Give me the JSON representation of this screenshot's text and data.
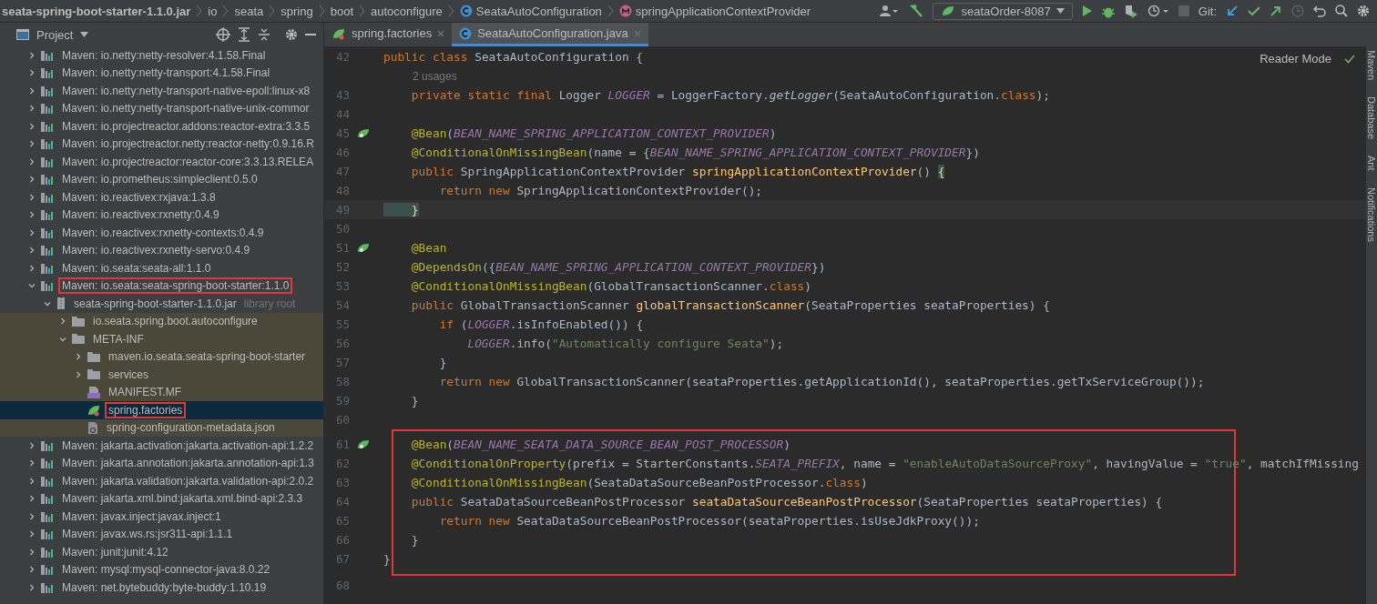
{
  "breadcrumb": [
    {
      "kind": "plain",
      "label": "seata-spring-boot-starter-1.1.0.jar"
    },
    {
      "kind": "plain",
      "label": "io"
    },
    {
      "kind": "plain",
      "label": "seata"
    },
    {
      "kind": "plain",
      "label": "spring"
    },
    {
      "kind": "plain",
      "label": "boot"
    },
    {
      "kind": "plain",
      "label": "autoconfigure"
    },
    {
      "kind": "class",
      "label": "SeataAutoConfiguration"
    },
    {
      "kind": "method",
      "label": "springApplicationContextProvider"
    }
  ],
  "toolbar": {
    "run_config": "seataOrder-8087",
    "git_label": "Git:"
  },
  "project_panel": {
    "title": "Project",
    "tree": [
      {
        "label": "Maven: io.netty:netty-resolver:4.1.58.Final",
        "kind": "library",
        "expanded": false,
        "selected": false,
        "boxed": false
      },
      {
        "label": "Maven: io.netty:netty-transport:4.1.58.Final",
        "kind": "library",
        "expanded": false,
        "selected": false,
        "boxed": false
      },
      {
        "label": "Maven: io.netty:netty-transport-native-epoll:linux-x8",
        "kind": "library",
        "expanded": false,
        "selected": false,
        "boxed": false
      },
      {
        "label": "Maven: io.netty:netty-transport-native-unix-commor",
        "kind": "library",
        "expanded": false,
        "selected": false,
        "boxed": false
      },
      {
        "label": "Maven: io.projectreactor.addons:reactor-extra:3.3.5",
        "kind": "library",
        "expanded": false,
        "selected": false,
        "boxed": false
      },
      {
        "label": "Maven: io.projectreactor.netty:reactor-netty:0.9.16.R",
        "kind": "library",
        "expanded": false,
        "selected": false,
        "boxed": false
      },
      {
        "label": "Maven: io.projectreactor:reactor-core:3.3.13.RELEA",
        "kind": "library",
        "expanded": false,
        "selected": false,
        "boxed": false
      },
      {
        "label": "Maven: io.prometheus:simpleclient:0.5.0",
        "kind": "library",
        "expanded": false,
        "selected": false,
        "boxed": false
      },
      {
        "label": "Maven: io.reactivex:rxjava:1.3.8",
        "kind": "library",
        "expanded": false,
        "selected": false,
        "boxed": false
      },
      {
        "label": "Maven: io.reactivex:rxnetty:0.4.9",
        "kind": "library",
        "expanded": false,
        "selected": false,
        "boxed": false
      },
      {
        "label": "Maven: io.reactivex:rxnetty-contexts:0.4.9",
        "kind": "library",
        "expanded": false,
        "selected": false,
        "boxed": false
      },
      {
        "label": "Maven: io.reactivex:rxnetty-servo:0.4.9",
        "kind": "library",
        "expanded": false,
        "selected": false,
        "boxed": false
      },
      {
        "label": "Maven: io.seata:seata-all:1.1.0",
        "kind": "library",
        "expanded": false,
        "selected": false,
        "boxed": false
      },
      {
        "label": "Maven: io.seata:seata-spring-boot-starter:1.1.0",
        "kind": "library",
        "expanded": true,
        "selected": false,
        "boxed": true,
        "children": [
          {
            "label": "seata-spring-boot-starter-1.1.0.jar",
            "note": "library root",
            "kind": "jar",
            "expanded": true,
            "selected": false,
            "boxed": false,
            "children": [
              {
                "label": "io.seata.spring.boot.autoconfigure",
                "kind": "folder",
                "expanded": false,
                "selected": false,
                "boxed": false
              },
              {
                "label": "META-INF",
                "kind": "folder",
                "expanded": true,
                "selected": false,
                "boxed": false,
                "children": [
                  {
                    "label": "maven.io.seata.seata-spring-boot-starter",
                    "kind": "folder",
                    "expanded": false,
                    "selected": false,
                    "boxed": false
                  },
                  {
                    "label": "services",
                    "kind": "folder",
                    "expanded": false,
                    "selected": false,
                    "boxed": false
                  },
                  {
                    "label": "MANIFEST.MF",
                    "kind": "manifest",
                    "selected": false,
                    "boxed": false
                  },
                  {
                    "label": "spring.factories",
                    "kind": "spring",
                    "selected": true,
                    "boxed": true
                  },
                  {
                    "label": "spring-configuration-metadata.json",
                    "kind": "json",
                    "selected": false,
                    "boxed": false
                  }
                ]
              }
            ]
          }
        ]
      },
      {
        "label": "Maven: jakarta.activation:jakarta.activation-api:1.2.2",
        "kind": "library",
        "expanded": false,
        "selected": false,
        "boxed": false
      },
      {
        "label": "Maven: jakarta.annotation:jakarta.annotation-api:1.3",
        "kind": "library",
        "expanded": false,
        "selected": false,
        "boxed": false
      },
      {
        "label": "Maven: jakarta.validation:jakarta.validation-api:2.0.2",
        "kind": "library",
        "expanded": false,
        "selected": false,
        "boxed": false
      },
      {
        "label": "Maven: jakarta.xml.bind:jakarta.xml.bind-api:2.3.3",
        "kind": "library",
        "expanded": false,
        "selected": false,
        "boxed": false
      },
      {
        "label": "Maven: javax.inject:javax.inject:1",
        "kind": "library",
        "expanded": false,
        "selected": false,
        "boxed": false
      },
      {
        "label": "Maven: javax.ws.rs:jsr311-api:1.1.1",
        "kind": "library",
        "expanded": false,
        "selected": false,
        "boxed": false
      },
      {
        "label": "Maven: junit:junit:4.12",
        "kind": "library",
        "expanded": false,
        "selected": false,
        "boxed": false
      },
      {
        "label": "Maven: mysql:mysql-connector-java:8.0.22",
        "kind": "library",
        "expanded": false,
        "selected": false,
        "boxed": false
      },
      {
        "label": "Maven: net.bytebuddy:byte-buddy:1.10.19",
        "kind": "library",
        "expanded": false,
        "selected": false,
        "boxed": false
      }
    ]
  },
  "tabs": [
    {
      "label": "spring.factories",
      "kind": "spring",
      "selected": false
    },
    {
      "label": "SeataAutoConfiguration.java",
      "kind": "class",
      "selected": true
    }
  ],
  "editor": {
    "reader_mode": "Reader Mode",
    "lines": [
      {
        "kind": "code",
        "number": "42",
        "bean_marker": false,
        "current": false,
        "boxed": false,
        "tokens": [
          {
            "kind": "keyword",
            "text": "public class "
          },
          {
            "kind": "plain",
            "text": "SeataAutoConfiguration {"
          }
        ]
      },
      {
        "kind": "hint",
        "text": "2 usages"
      },
      {
        "kind": "code",
        "number": "43",
        "bean_marker": false,
        "current": false,
        "boxed": false,
        "tokens": [
          {
            "kind": "keyword",
            "text": "    private static final "
          },
          {
            "kind": "plain",
            "text": "Logger "
          },
          {
            "kind": "constant",
            "text": "LOGGER"
          },
          {
            "kind": "plain",
            "text": " = LoggerFactory."
          },
          {
            "kind": "call",
            "text": "getLogger"
          },
          {
            "kind": "plain",
            "text": "(SeataAutoConfiguration."
          },
          {
            "kind": "keyword",
            "text": "class"
          },
          {
            "kind": "plain",
            "text": ");"
          }
        ]
      },
      {
        "kind": "code",
        "number": "44",
        "bean_marker": false,
        "current": false,
        "boxed": false
      },
      {
        "kind": "code",
        "number": "45",
        "bean_marker": true,
        "current": false,
        "boxed": false,
        "tokens": [
          {
            "kind": "annotation",
            "text": "    @Bean"
          },
          {
            "kind": "plain",
            "text": "("
          },
          {
            "kind": "constant",
            "text": "BEAN_NAME_SPRING_APPLICATION_CONTEXT_PROVIDER"
          },
          {
            "kind": "plain",
            "text": ")"
          }
        ]
      },
      {
        "kind": "code",
        "number": "46",
        "bean_marker": false,
        "current": false,
        "boxed": false,
        "tokens": [
          {
            "kind": "annotation",
            "text": "    @ConditionalOnMissingBean"
          },
          {
            "kind": "plain",
            "text": "(name = {"
          },
          {
            "kind": "constant",
            "text": "BEAN_NAME_SPRING_APPLICATION_CONTEXT_PROVIDER"
          },
          {
            "kind": "plain",
            "text": "})"
          }
        ]
      },
      {
        "kind": "code",
        "number": "47",
        "bean_marker": false,
        "current": false,
        "boxed": false,
        "tokens": [
          {
            "kind": "keyword",
            "text": "    public "
          },
          {
            "kind": "plain",
            "text": "SpringApplicationContextProvider "
          },
          {
            "kind": "method",
            "text": "springApplicationContextProvider"
          },
          {
            "kind": "plain",
            "text": "() "
          },
          {
            "kind": "brace",
            "text": "{"
          }
        ]
      },
      {
        "kind": "code",
        "number": "48",
        "bean_marker": false,
        "current": false,
        "boxed": false,
        "tokens": [
          {
            "kind": "keyword",
            "text": "        return new "
          },
          {
            "kind": "plain",
            "text": "SpringApplicationContextProvider();"
          }
        ]
      },
      {
        "kind": "code",
        "number": "49",
        "bean_marker": false,
        "current": true,
        "boxed": false,
        "tokens": [
          {
            "kind": "brace",
            "text": "    }"
          }
        ]
      },
      {
        "kind": "code",
        "number": "50",
        "bean_marker": false,
        "current": false,
        "boxed": false
      },
      {
        "kind": "code",
        "number": "51",
        "bean_marker": true,
        "current": false,
        "boxed": false,
        "tokens": [
          {
            "kind": "annotation",
            "text": "    @Bean"
          }
        ]
      },
      {
        "kind": "code",
        "number": "52",
        "bean_marker": false,
        "current": false,
        "boxed": false,
        "tokens": [
          {
            "kind": "annotation",
            "text": "    @DependsOn"
          },
          {
            "kind": "plain",
            "text": "({"
          },
          {
            "kind": "constant",
            "text": "BEAN_NAME_SPRING_APPLICATION_CONTEXT_PROVIDER"
          },
          {
            "kind": "plain",
            "text": "})"
          }
        ]
      },
      {
        "kind": "code",
        "number": "53",
        "bean_marker": false,
        "current": false,
        "boxed": false,
        "tokens": [
          {
            "kind": "annotation",
            "text": "    @ConditionalOnMissingBean"
          },
          {
            "kind": "plain",
            "text": "(GlobalTransactionScanner."
          },
          {
            "kind": "keyword",
            "text": "class"
          },
          {
            "kind": "plain",
            "text": ")"
          }
        ]
      },
      {
        "kind": "code",
        "number": "54",
        "bean_marker": false,
        "current": false,
        "boxed": false,
        "tokens": [
          {
            "kind": "keyword",
            "text": "    public "
          },
          {
            "kind": "plain",
            "text": "GlobalTransactionScanner "
          },
          {
            "kind": "method",
            "text": "globalTransactionScanner"
          },
          {
            "kind": "plain",
            "text": "(SeataProperties seataProperties) {"
          }
        ]
      },
      {
        "kind": "code",
        "number": "55",
        "bean_marker": false,
        "current": false,
        "boxed": false,
        "tokens": [
          {
            "kind": "keyword",
            "text": "        if "
          },
          {
            "kind": "plain",
            "text": "("
          },
          {
            "kind": "constant",
            "text": "LOGGER"
          },
          {
            "kind": "plain",
            "text": ".isInfoEnabled()) {"
          }
        ]
      },
      {
        "kind": "code",
        "number": "56",
        "bean_marker": false,
        "current": false,
        "boxed": false,
        "tokens": [
          {
            "kind": "constant",
            "text": "            LOGGER"
          },
          {
            "kind": "plain",
            "text": ".info("
          },
          {
            "kind": "string",
            "text": "\"Automatically configure Seata\""
          },
          {
            "kind": "plain",
            "text": ");"
          }
        ]
      },
      {
        "kind": "code",
        "number": "57",
        "bean_marker": false,
        "current": false,
        "boxed": false,
        "tokens": [
          {
            "kind": "plain",
            "text": "        }"
          }
        ]
      },
      {
        "kind": "code",
        "number": "58",
        "bean_marker": false,
        "current": false,
        "boxed": false,
        "tokens": [
          {
            "kind": "keyword",
            "text": "        return new "
          },
          {
            "kind": "plain",
            "text": "GlobalTransactionScanner(seataProperties.getApplicationId(), seataProperties.getTxServiceGroup());"
          }
        ]
      },
      {
        "kind": "code",
        "number": "59",
        "bean_marker": false,
        "current": false,
        "boxed": false,
        "tokens": [
          {
            "kind": "plain",
            "text": "    }"
          }
        ]
      },
      {
        "kind": "code",
        "number": "60",
        "bean_marker": false,
        "current": false,
        "boxed": false
      },
      {
        "kind": "code",
        "number": "61",
        "bean_marker": true,
        "current": false,
        "boxed": true,
        "tokens": [
          {
            "kind": "annotation",
            "text": "    @Bean"
          },
          {
            "kind": "plain",
            "text": "("
          },
          {
            "kind": "constant",
            "text": "BEAN_NAME_SEATA_DATA_SOURCE_BEAN_POST_PROCESSOR"
          },
          {
            "kind": "plain",
            "text": ")"
          }
        ]
      },
      {
        "kind": "code",
        "number": "62",
        "bean_marker": false,
        "current": false,
        "boxed": true,
        "tokens": [
          {
            "kind": "annotation",
            "text": "    @ConditionalOnProperty"
          },
          {
            "kind": "plain",
            "text": "(prefix = StarterConstants."
          },
          {
            "kind": "constant",
            "text": "SEATA_PREFIX"
          },
          {
            "kind": "plain",
            "text": ", name = "
          },
          {
            "kind": "string",
            "text": "\"enableAutoDataSourceProxy\""
          },
          {
            "kind": "plain",
            "text": ", havingValue = "
          },
          {
            "kind": "string",
            "text": "\"true\""
          },
          {
            "kind": "plain",
            "text": ", matchIfMissing"
          }
        ]
      },
      {
        "kind": "code",
        "number": "63",
        "bean_marker": false,
        "current": false,
        "boxed": true,
        "tokens": [
          {
            "kind": "annotation",
            "text": "    @ConditionalOnMissingBean"
          },
          {
            "kind": "plain",
            "text": "(SeataDataSourceBeanPostProcessor."
          },
          {
            "kind": "keyword",
            "text": "class"
          },
          {
            "kind": "plain",
            "text": ")"
          }
        ]
      },
      {
        "kind": "code",
        "number": "64",
        "bean_marker": false,
        "current": false,
        "boxed": true,
        "tokens": [
          {
            "kind": "keyword",
            "text": "    public "
          },
          {
            "kind": "plain",
            "text": "SeataDataSourceBeanPostProcessor "
          },
          {
            "kind": "method",
            "text": "seataDataSourceBeanPostProcessor"
          },
          {
            "kind": "plain",
            "text": "(SeataProperties seataProperties) {"
          }
        ]
      },
      {
        "kind": "code",
        "number": "65",
        "bean_marker": false,
        "current": false,
        "boxed": true,
        "tokens": [
          {
            "kind": "keyword",
            "text": "        return new "
          },
          {
            "kind": "plain",
            "text": "SeataDataSourceBeanPostProcessor(seataProperties.isUseJdkProxy());"
          }
        ]
      },
      {
        "kind": "code",
        "number": "66",
        "bean_marker": false,
        "current": false,
        "boxed": true,
        "tokens": [
          {
            "kind": "plain",
            "text": "    }"
          }
        ]
      },
      {
        "kind": "code",
        "number": "67",
        "bean_marker": false,
        "current": false,
        "boxed": true,
        "tokens": [
          {
            "kind": "plain",
            "text": "}"
          }
        ]
      },
      {
        "kind": "code",
        "number": "68",
        "bean_marker": false,
        "current": false,
        "boxed": false
      }
    ]
  },
  "right_strip": [
    "Maven",
    "Database",
    "Ant",
    "Notifications"
  ]
}
